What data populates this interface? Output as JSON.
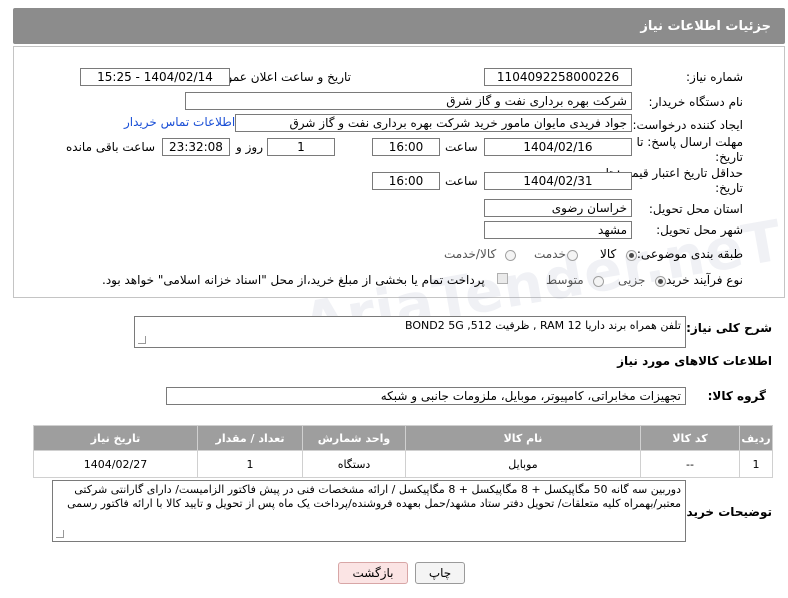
{
  "header": {
    "title": "جزئیات اطلاعات نیاز"
  },
  "form": {
    "need_number_label": "شماره نیاز:",
    "need_number_value": "1104092258000226",
    "announce_label": "تاریخ و ساعت اعلان عمومی:",
    "announce_value": "1404/02/14 - 15:25",
    "buyer_org_label": "نام دستگاه خریدار:",
    "buyer_org_value": "شرکت بهره برداری نفت و گاز شرق",
    "creator_label": "ایجاد کننده درخواست:",
    "creator_value": "جواد فریدی مایوان مامور خرید شرکت بهره برداری نفت و گاز شرق",
    "contact_link": "اطلاعات تماس خریدار",
    "reply_deadline_label": "مهلت ارسال پاسخ: تا تاریخ:",
    "reply_date": "1404/02/16",
    "time_label": "ساعت",
    "reply_time": "16:00",
    "days_value": "1",
    "days_label": "روز و",
    "remaining_time": "23:32:08",
    "remaining_label": "ساعت باقی مانده",
    "price_validity_label": "حداقل تاریخ اعتبار قیمت: تا تاریخ:",
    "price_date": "1404/02/31",
    "price_time": "16:00",
    "province_label": "استان محل تحویل:",
    "province_value": "خراسان رضوی",
    "city_label": "شهر محل تحویل:",
    "city_value": "مشهد",
    "category_label": "طبقه بندی موضوعی:",
    "category_options": [
      "کالا",
      "خدمت",
      "کالا/خدمت"
    ],
    "category_selected": "کالا",
    "process_label": "نوع فرآیند خرید :",
    "process_options": [
      "جزیی",
      "متوسط"
    ],
    "process_selected": "جزیی",
    "payment_note": "پرداخت تمام یا بخشی از مبلغ خرید،از محل \"اسناد خزانه اسلامی\" خواهد بود."
  },
  "description": {
    "label": "شرح کلی نیاز:",
    "value": "تلفن همراه برند داریا RAM 12 , ظرفیت 512,   BOND2 5G"
  },
  "goods_info": {
    "title": "اطلاعات کالاهای مورد نیاز",
    "group_label": "گروه کالا:",
    "group_value": "تجهیزات مخابراتی، کامپیوتر، موبایل، ملزومات جانبی و شبکه"
  },
  "table": {
    "headers": [
      "ردیف",
      "کد کالا",
      "نام کالا",
      "واحد شمارش",
      "تعداد / مقدار",
      "تاریخ نیاز"
    ],
    "rows": [
      [
        "1",
        "--",
        "موبایل",
        "دستگاه",
        "1",
        "1404/02/27"
      ]
    ]
  },
  "buyer_notes": {
    "label": "توضیحات خریدار:",
    "value": "دوربین سه گانه 50 مگاپیکسل + 8 مگاپیکسل + 8 مگاپیکسل / ارائه مشخصات فنی در پیش فاکتور الزامیست/ دارای گارانتی شرکتی معتبر/بهمراه کلیه متعلقات/ تحویل دفتر ستاد مشهد/حمل بعهده فروشنده/پرداخت یک ماه پس از تحویل و تایید کالا با ارائه فاکتور رسمی"
  },
  "buttons": {
    "print": "چاپ",
    "back": "بازگشت"
  },
  "watermark": "AriaTender.neT"
}
